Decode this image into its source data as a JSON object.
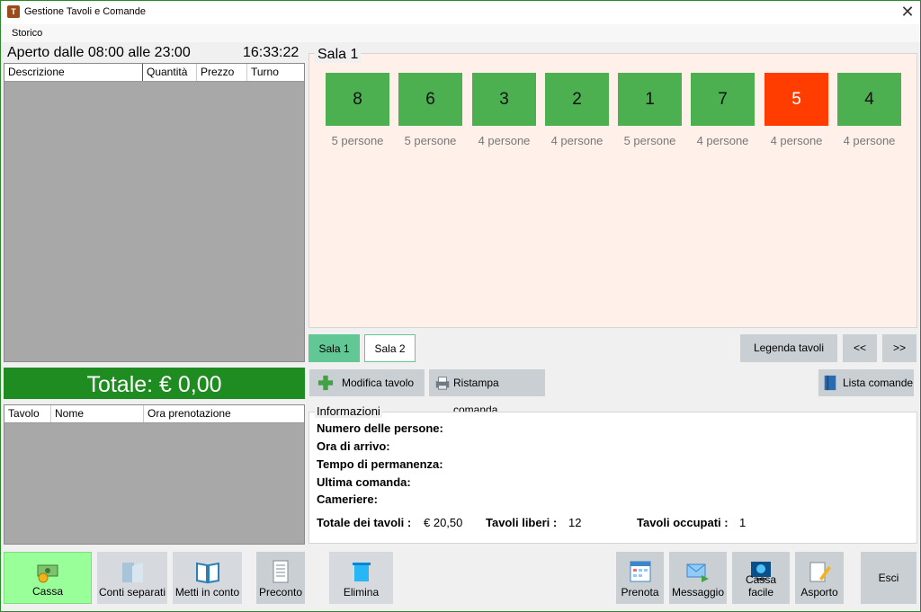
{
  "window": {
    "title": "Gestione Tavoli e Comande",
    "close_glyph": "✕"
  },
  "menu": {
    "storico": "Storico"
  },
  "left": {
    "open_hours": "Aperto dalle 08:00 alle 23:00",
    "clock": "16:33:22",
    "order_columns": [
      "Descrizione",
      "Quantità",
      "Prezzo",
      "Turno"
    ],
    "total": "Totale: € 0,00",
    "reservation_columns": [
      "Tavolo",
      "Nome",
      "Ora prenotazione"
    ]
  },
  "sala": {
    "title": "Sala 1",
    "tables": [
      {
        "number": "8",
        "persons": "5 persone",
        "status": "free"
      },
      {
        "number": "6",
        "persons": "5 persone",
        "status": "free"
      },
      {
        "number": "3",
        "persons": "4 persone",
        "status": "free"
      },
      {
        "number": "2",
        "persons": "4 persone",
        "status": "free"
      },
      {
        "number": "1",
        "persons": "5 persone",
        "status": "free"
      },
      {
        "number": "7",
        "persons": "4 persone",
        "status": "free"
      },
      {
        "number": "5",
        "persons": "4 persone",
        "status": "occupied"
      },
      {
        "number": "4",
        "persons": "4 persone",
        "status": "free"
      }
    ],
    "colors": {
      "free": "#4caf50",
      "occupied": "#ff3d00",
      "background": "#fff1ea"
    }
  },
  "rooms": {
    "tabs": [
      "Sala 1",
      "Sala 2"
    ],
    "active": "Sala 1"
  },
  "nav": {
    "legend": "Legenda tavoli",
    "prev": "<<",
    "next": ">>"
  },
  "actions": {
    "edit_table": "Modifica tavolo",
    "reprint": "Ristampa comanda",
    "orders_list": "Lista comande"
  },
  "info": {
    "title": "Informazioni",
    "labels": [
      "Numero delle persone:",
      "Ora di arrivo:",
      "Tempo di permanenza:",
      "Ultima comanda:",
      "Cameriere:"
    ],
    "total_label": "Totale dei tavoli :",
    "total_value": "€ 20,50",
    "free_label": "Tavoli liberi :",
    "free_value": "12",
    "occupied_label": "Tavoli occupati :",
    "occupied_value": "1"
  },
  "bottom": {
    "cassa": "Cassa",
    "conti": "Conti separati",
    "metti": "Metti in conto",
    "preconto": "Preconto",
    "elimina": "Elimina",
    "prenota": "Prenota",
    "messaggio": "Messaggio",
    "cassa_facile": "Cassa facile",
    "asporto": "Asporto",
    "esci": "Esci"
  }
}
